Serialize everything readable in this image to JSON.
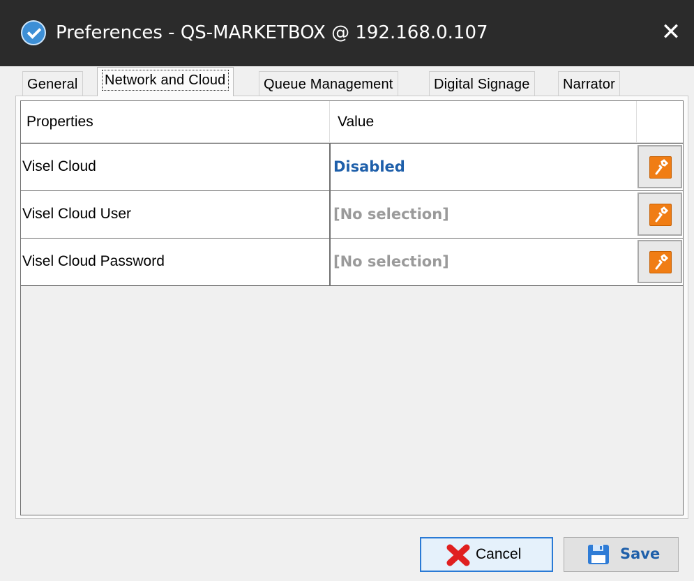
{
  "window": {
    "title": "Preferences - QS-MARKETBOX @ 192.168.0.107",
    "app_icon": "app-logo-icon",
    "close_glyph": "✕"
  },
  "tabs": [
    {
      "label": "General",
      "active": false
    },
    {
      "label": "Network and Cloud",
      "active": true
    },
    {
      "label": "Queue Management",
      "active": false
    },
    {
      "label": "Digital Signage",
      "active": false
    },
    {
      "label": "Narrator",
      "active": false
    }
  ],
  "table": {
    "headers": {
      "properties": "Properties",
      "value": "Value"
    },
    "rows": [
      {
        "property": "Visel Cloud",
        "value": "Disabled",
        "value_style": "active",
        "action_icon": "wrench-icon"
      },
      {
        "property": "Visel Cloud User",
        "value": "[No selection]",
        "value_style": "empty",
        "action_icon": "wrench-icon"
      },
      {
        "property": "Visel Cloud Password",
        "value": "[No selection]",
        "value_style": "empty",
        "action_icon": "wrench-icon"
      }
    ]
  },
  "footer": {
    "cancel_label": "Cancel",
    "save_label": "Save"
  },
  "colors": {
    "titlebar": "#2b2b2b",
    "value_active": "#1e5faa",
    "value_empty": "#9a9a9a",
    "wrench_accent": "#f07d14",
    "cancel_focus": "#2a7ad5"
  }
}
